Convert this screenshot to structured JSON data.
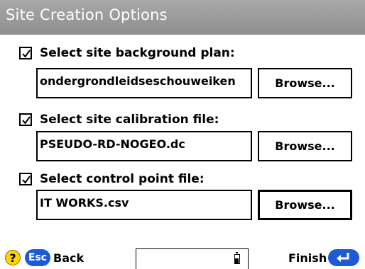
{
  "window": {
    "title": "Site Creation Options"
  },
  "options": [
    {
      "label": "Select site background plan:",
      "checked": true,
      "file": "ondergrondleidseschouweiken",
      "browse": "Browse..."
    },
    {
      "label": "Select site calibration file:",
      "checked": true,
      "file": "PSEUDO-RD-NOGEO.dc",
      "browse": "Browse..."
    },
    {
      "label": "Select control point file:",
      "checked": true,
      "file": "IT WORKS.csv",
      "browse": "Browse..."
    }
  ],
  "footer": {
    "help": "?",
    "esc": "Esc",
    "back": "Back",
    "finish": "Finish"
  },
  "colors": {
    "titlebar": "#999999",
    "accent_blue": "#1d5bd6",
    "help_yellow": "#ffd400"
  }
}
